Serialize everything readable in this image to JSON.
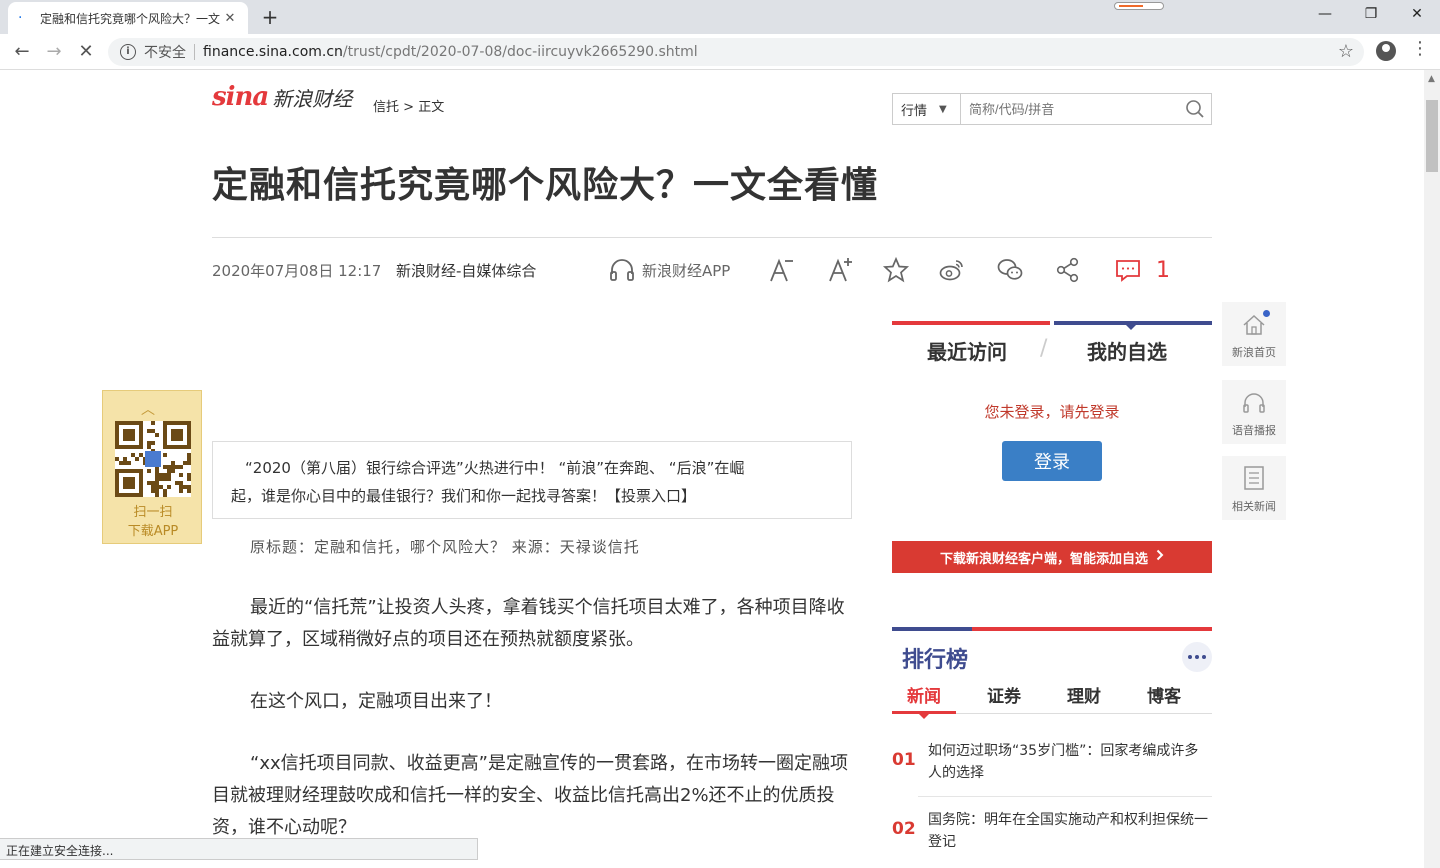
{
  "browser": {
    "tab_title": "定融和信托究竟哪个风险大？一文",
    "tab_close": "✕",
    "new_tab": "+",
    "insecure_label": "不安全",
    "url_host": "finance.sina.com.cn",
    "url_path": "/trust/cpdt/2020-07-08/doc-iircuyvk2665290.shtml",
    "status_text": "正在建立安全连接..."
  },
  "header": {
    "logo_sina": "sina",
    "logo_name": "新浪财经",
    "breadcrumb": [
      "信托",
      ">",
      "正文"
    ],
    "search_select": "行情",
    "search_placeholder": "简称/代码/拼音"
  },
  "article": {
    "title": "定融和信托究竟哪个风险大？一文全看懂",
    "date": "2020年07月08日 12:17",
    "source": "新浪财经-自媒体综合",
    "app_label": "新浪财经APP",
    "comment_count": "1",
    "notice_line1": "“2020（第八届）银行综合评选”火热进行中！ “前浪”在奔跑、 “后浪”在崛",
    "notice_line2": "起，谁是你心目中的最佳银行？我们和你一起找寻答案！【投票入口】",
    "original": "原标题：定融和信托，哪个风险大？ 来源：天禄谈信托",
    "paragraphs": [
      "最近的“信托荒”让投资人头疼，拿着钱买个信托项目太难了，各种项目降收益就算了，区域稍微好点的项目还在预热就额度紧张。",
      "在这个风口，定融项目出来了！",
      "“xx信托项目同款、收益更高”是定融宣传的一贯套路，在市场转一圈定融项目就被理财经理鼓吹成和信托一样的安全、收益比信托高出2%还不止的优质投资，谁不心动呢？"
    ]
  },
  "qr": {
    "line1": "扫一扫",
    "line2": "下载APP"
  },
  "sidebar": {
    "tab_recent": "最近访问",
    "tab_slash": "/",
    "tab_mine": "我的自选",
    "login_msg": "您未登录，请先登录",
    "login_btn": "登录",
    "download_bar": "下载新浪财经客户端，智能添加自选",
    "rank_title": "排行榜",
    "rank_tabs": [
      "新闻",
      "证券",
      "理财",
      "博客"
    ],
    "rank_items": [
      {
        "num": "01",
        "text": "如何迈过职场“35岁门槛”：回家考编成许多人的选择"
      },
      {
        "num": "02",
        "text": "国务院：明年在全国实施动产和权利担保统一登记"
      }
    ]
  },
  "dock": {
    "home": "新浪首页",
    "voice": "语音播报",
    "related": "相关新闻"
  },
  "colors": {
    "brand_red": "#e4393c",
    "navy": "#3f4c8f",
    "login_blue": "#3a7fc6"
  }
}
